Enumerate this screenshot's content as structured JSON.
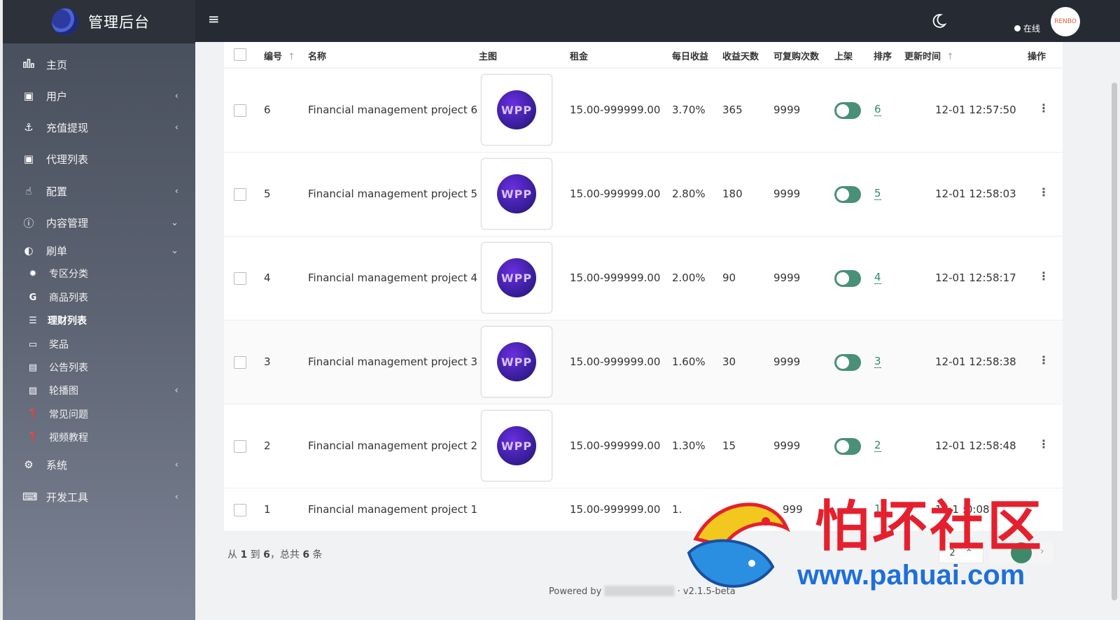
{
  "brand": {
    "title": "管理后台"
  },
  "sidebar": {
    "items": [
      {
        "label": "主页",
        "icon": "bar-chart-icon",
        "has_arrow": false
      },
      {
        "label": "用户",
        "icon": "user-card-icon",
        "has_arrow": true
      },
      {
        "label": "充值提现",
        "icon": "anchor-icon",
        "has_arrow": true
      },
      {
        "label": "代理列表",
        "icon": "user-card-icon",
        "has_arrow": false
      },
      {
        "label": "配置",
        "icon": "hand-icon",
        "has_arrow": true
      },
      {
        "label": "内容管理",
        "icon": "question-circle-icon",
        "expanded": true
      },
      {
        "label": "刷单",
        "icon": "half-circle-icon",
        "expanded": true
      }
    ],
    "subitems": [
      {
        "label": "专区分类",
        "icon": "gear-icon"
      },
      {
        "label": "商品列表",
        "icon": "g-icon"
      },
      {
        "label": "理财列表",
        "icon": "list-icon",
        "active": true
      },
      {
        "label": "奖品",
        "icon": "money-icon"
      },
      {
        "label": "公告列表",
        "icon": "document-icon"
      }
    ],
    "items2": [
      {
        "label": "轮播图",
        "icon": "image-icon",
        "has_arrow": true
      },
      {
        "label": "常见问题",
        "icon": "question-icon"
      },
      {
        "label": "视频教程",
        "icon": "question-icon"
      }
    ],
    "items3": [
      {
        "label": "系统",
        "icon": "gear-icon",
        "has_arrow": true
      },
      {
        "label": "开发工具",
        "icon": "keyboard-icon",
        "has_arrow": true
      }
    ]
  },
  "topbar": {
    "online_label": "在线",
    "avatar_text": "RENBO"
  },
  "table": {
    "headers": [
      "编号",
      "名称",
      "主图",
      "租金",
      "每日收益",
      "收益天数",
      "可复购次数",
      "上架",
      "排序",
      "更新时间",
      "操作"
    ],
    "rows": [
      {
        "id": "6",
        "name": "Financial management project 6",
        "thumb": "WPP",
        "rent": "15.00-999999.00",
        "daily": "3.70%",
        "days": "365",
        "rebuy": "9999",
        "sort": "6",
        "updated": "12-01 12:57:50"
      },
      {
        "id": "5",
        "name": "Financial management project 5",
        "thumb": "WPP",
        "rent": "15.00-999999.00",
        "daily": "2.80%",
        "days": "180",
        "rebuy": "9999",
        "sort": "5",
        "updated": "12-01 12:58:03"
      },
      {
        "id": "4",
        "name": "Financial management project 4",
        "thumb": "WPP",
        "rent": "15.00-999999.00",
        "daily": "2.00%",
        "days": "90",
        "rebuy": "9999",
        "sort": "4",
        "updated": "12-01 12:58:17"
      },
      {
        "id": "3",
        "name": "Financial management project 3",
        "thumb": "WPP",
        "rent": "15.00-999999.00",
        "daily": "1.60%",
        "days": "30",
        "rebuy": "9999",
        "sort": "3",
        "updated": "12-01 12:58:38"
      },
      {
        "id": "2",
        "name": "Financial management project 2",
        "thumb": "WPP",
        "rent": "15.00-999999.00",
        "daily": "1.30%",
        "days": "15",
        "rebuy": "9999",
        "sort": "2",
        "updated": "12-01 12:58:48"
      },
      {
        "id": "1",
        "name": "Financial management project 1",
        "thumb": "",
        "rent": "15.00-999999.00",
        "daily": "1.",
        "days": "",
        "rebuy": "999",
        "sort": "1",
        "updated": "12-1 :0:08"
      }
    ]
  },
  "pager": {
    "prefix": "从",
    "from": "1",
    "mid": "到",
    "to": "6",
    "total_prefix": "，总共",
    "total": "6",
    "suffix": "条",
    "page_size": "2"
  },
  "footer": {
    "powered": "Powered by",
    "version": "v2.1.5-beta"
  },
  "watermark": {
    "text": "怕坏社区",
    "url": "www.pahuai.com"
  }
}
